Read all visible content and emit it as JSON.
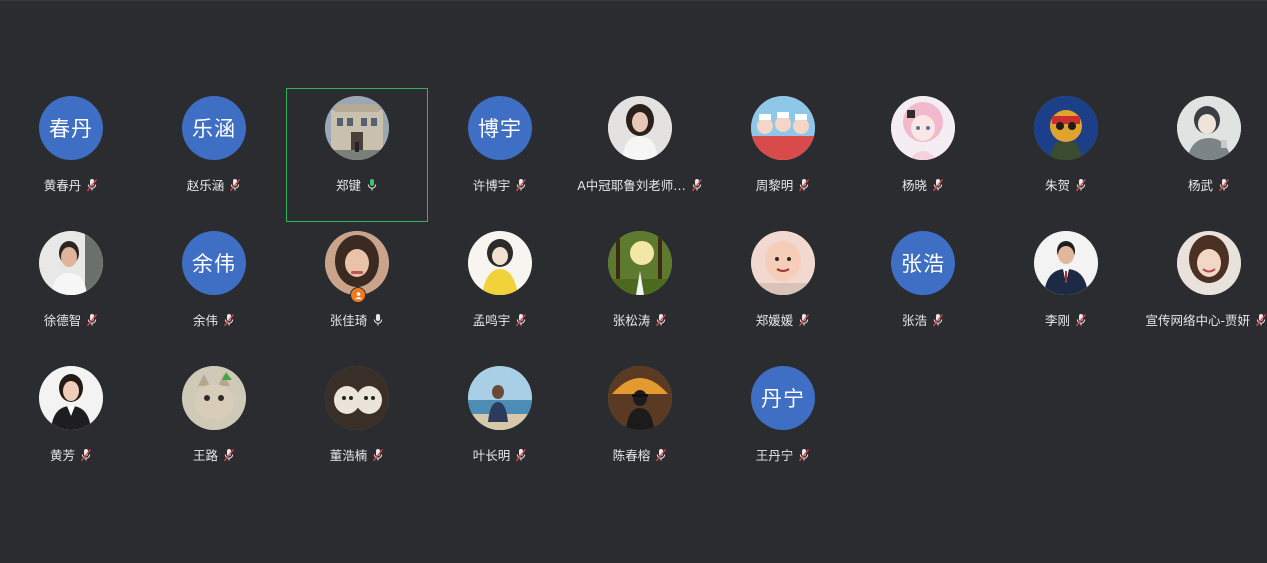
{
  "participants": [
    {
      "name": "黄春丹",
      "initials": "春丹",
      "avatar": "initials",
      "mic": "muted"
    },
    {
      "name": "赵乐涵",
      "initials": "乐涵",
      "avatar": "initials",
      "mic": "muted"
    },
    {
      "name": "郑键",
      "initials": "",
      "avatar": "photo-building",
      "mic": "active",
      "speaking": true
    },
    {
      "name": "许博宇",
      "initials": "博宇",
      "avatar": "initials",
      "mic": "muted"
    },
    {
      "name": "A中冠耶鲁刘老师…",
      "initials": "",
      "avatar": "photo-woman-white",
      "mic": "muted"
    },
    {
      "name": "周黎明",
      "initials": "",
      "avatar": "photo-anime-group",
      "mic": "muted"
    },
    {
      "name": "杨晓",
      "initials": "",
      "avatar": "photo-anime-pink",
      "mic": "muted"
    },
    {
      "name": "朱贺",
      "initials": "",
      "avatar": "photo-cartoon-hero",
      "mic": "muted"
    },
    {
      "name": "杨武",
      "initials": "",
      "avatar": "photo-sketch-man",
      "mic": "muted"
    },
    {
      "name": "徐德智",
      "initials": "",
      "avatar": "photo-man-white",
      "mic": "muted"
    },
    {
      "name": "余伟",
      "initials": "余伟",
      "avatar": "initials",
      "mic": "muted"
    },
    {
      "name": "张佳琦",
      "initials": "",
      "avatar": "photo-girl-hair",
      "mic": "active",
      "host_badge": true
    },
    {
      "name": "孟鸣宇",
      "initials": "",
      "avatar": "photo-girl-yellow",
      "mic": "muted"
    },
    {
      "name": "张松涛",
      "initials": "",
      "avatar": "photo-forest",
      "mic": "muted"
    },
    {
      "name": "郑媛媛",
      "initials": "",
      "avatar": "photo-baby",
      "mic": "muted"
    },
    {
      "name": "张浩",
      "initials": "张浩",
      "avatar": "initials",
      "mic": "muted"
    },
    {
      "name": "李刚",
      "initials": "",
      "avatar": "photo-man-suit",
      "mic": "muted"
    },
    {
      "name": "宣传网络中心-贾妍",
      "initials": "",
      "avatar": "photo-woman-smile",
      "mic": "muted"
    },
    {
      "name": "黄芳",
      "initials": "",
      "avatar": "photo-woman-suit",
      "mic": "muted"
    },
    {
      "name": "王路",
      "initials": "",
      "avatar": "photo-cat",
      "mic": "muted"
    },
    {
      "name": "董浩楠",
      "initials": "",
      "avatar": "photo-puppies",
      "mic": "muted"
    },
    {
      "name": "叶长明",
      "initials": "",
      "avatar": "photo-beach-man",
      "mic": "muted"
    },
    {
      "name": "陈春榕",
      "initials": "",
      "avatar": "photo-woman-umbrella",
      "mic": "muted"
    },
    {
      "name": "王丹宁",
      "initials": "丹宁",
      "avatar": "initials",
      "mic": "muted"
    }
  ],
  "colors": {
    "background": "#2b2c2f",
    "initials_avatar": "#3e6fc4",
    "speaking_border": "#2fb35b",
    "mic_active": "#3cc46b",
    "mic_muted_slash": "#e0434b",
    "host_badge": "#f07a1f"
  }
}
